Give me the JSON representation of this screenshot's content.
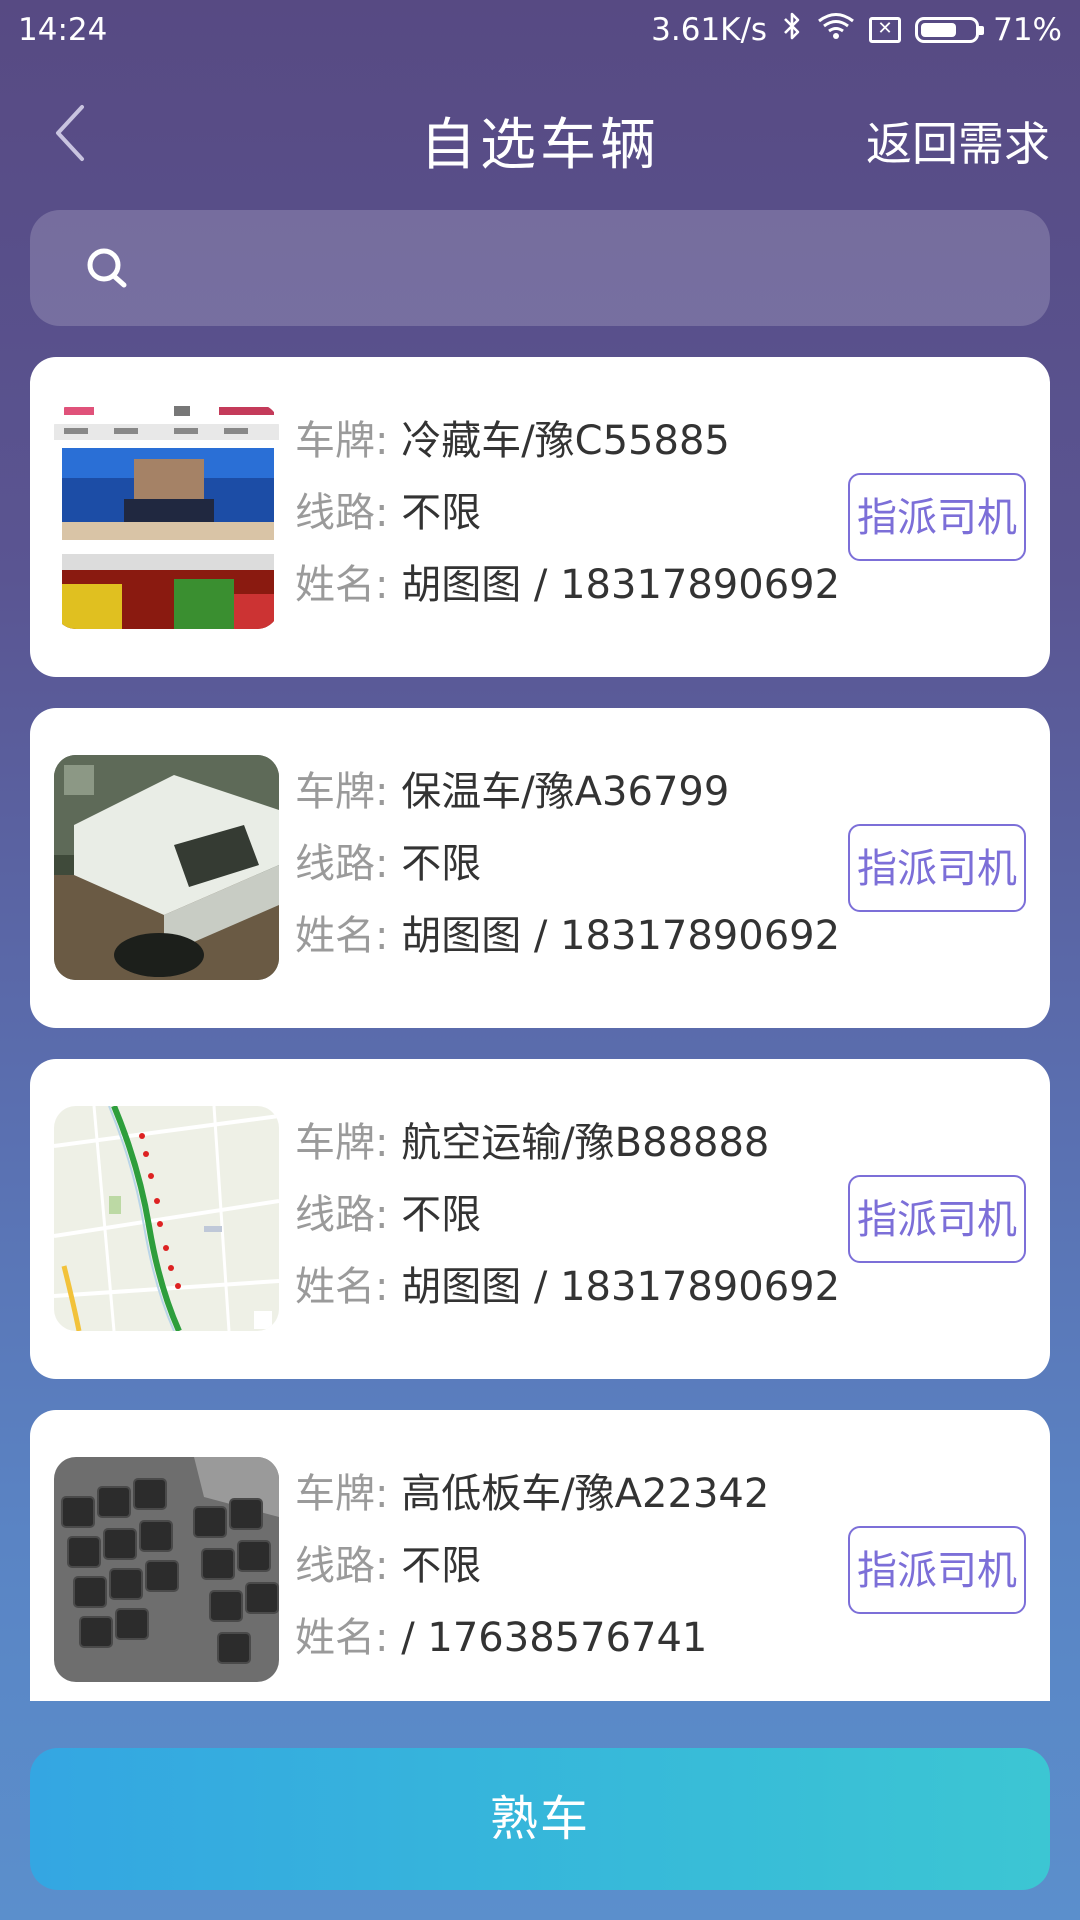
{
  "status_bar": {
    "time": "14:24",
    "speed": "3.61K/s",
    "battery_text": "71%",
    "battery_level": 0.71,
    "icons": [
      "bluetooth-icon",
      "wifi-icon",
      "no-sim-icon",
      "battery-icon"
    ]
  },
  "header": {
    "title": "自选车辆",
    "return_label": "返回需求",
    "back_icon": "chevron-left-icon"
  },
  "search": {
    "placeholder": "",
    "value": "",
    "icon": "search-icon"
  },
  "vehicles": [
    {
      "plate_label": "车牌:",
      "plate": "冷藏车/豫C55885",
      "route_label": "线路:",
      "route": "不限",
      "name_label": "姓名:",
      "name": "胡图图 / 18317890692",
      "assign_label": "指派司机",
      "thumb": "tv-screenshot"
    },
    {
      "plate_label": "车牌:",
      "plate": "保温车/豫A36799",
      "route_label": "线路:",
      "route": "不限",
      "name_label": "姓名:",
      "name": "胡图图 / 18317890692",
      "assign_label": "指派司机",
      "thumb": "box-photo"
    },
    {
      "plate_label": "车牌:",
      "plate": "航空运输/豫B88888",
      "route_label": "线路:",
      "route": "不限",
      "name_label": "姓名:",
      "name": "胡图图 / 18317890692",
      "assign_label": "指派司机",
      "thumb": "map-image"
    },
    {
      "plate_label": "车牌:",
      "plate": "高低板车/豫A22342",
      "route_label": "线路:",
      "route": "不限",
      "name_label": "姓名:",
      "name": " / 17638576741",
      "assign_label": "指派司机",
      "thumb": "keyboard-photo"
    }
  ],
  "bottom_button": {
    "label": "熟车"
  },
  "colors": {
    "accent": "#7c6fd8",
    "button_gradient_start": "#34a6e2",
    "button_gradient_end": "#3cc6d3"
  }
}
